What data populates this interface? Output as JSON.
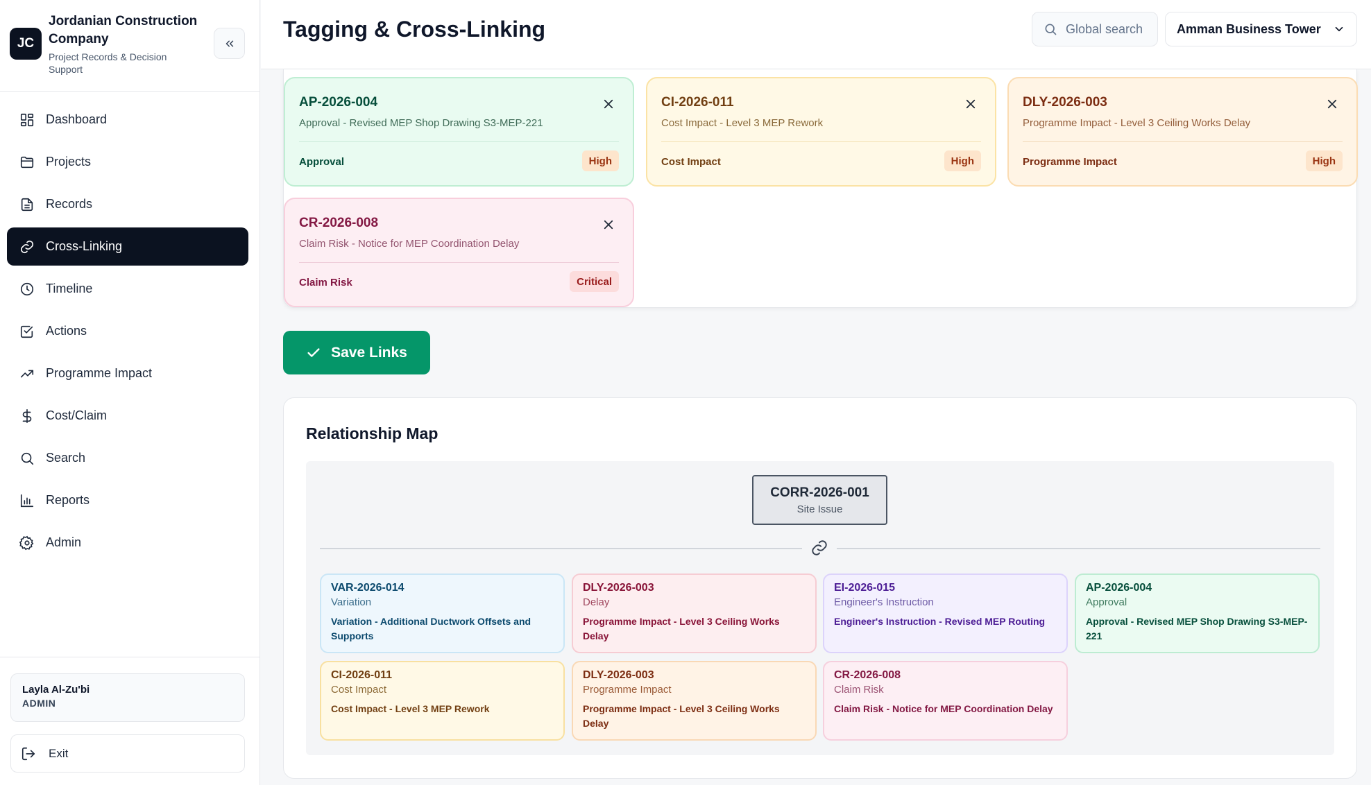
{
  "brand": {
    "logo": "JC",
    "name": "Jordanian Construction Company",
    "subtitle": "Project Records & Decision Support"
  },
  "sidebar": {
    "collapse_icon": "chevrons-left-icon",
    "items": [
      {
        "label": "Dashboard",
        "icon": "grid-icon",
        "active": false
      },
      {
        "label": "Projects",
        "icon": "folder-icon",
        "active": false
      },
      {
        "label": "Records",
        "icon": "file-icon",
        "active": false
      },
      {
        "label": "Cross-Linking",
        "icon": "link-icon",
        "active": true
      },
      {
        "label": "Timeline",
        "icon": "clock-icon",
        "active": false
      },
      {
        "label": "Actions",
        "icon": "checkbox-icon",
        "active": false
      },
      {
        "label": "Programme Impact",
        "icon": "trending-up-icon",
        "active": false
      },
      {
        "label": "Cost/Claim",
        "icon": "dollar-icon",
        "active": false
      },
      {
        "label": "Search",
        "icon": "search-icon",
        "active": false
      },
      {
        "label": "Reports",
        "icon": "bar-chart-icon",
        "active": false
      },
      {
        "label": "Admin",
        "icon": "gear-icon",
        "active": false
      }
    ],
    "user": {
      "name": "Layla Al-Zu'bi",
      "role": "ADMIN"
    },
    "exit_label": "Exit"
  },
  "header": {
    "title": "Tagging & Cross-Linking",
    "search_placeholder": "Global search",
    "project": "Amman Business Tower"
  },
  "linked_records": [
    {
      "id": "AP-2026-004",
      "description": "Approval - Revised MEP Shop Drawing S3-MEP-221",
      "category": "Approval",
      "priority": "High",
      "color": "green"
    },
    {
      "id": "CI-2026-011",
      "description": "Cost Impact - Level 3 MEP Rework",
      "category": "Cost Impact",
      "priority": "High",
      "color": "yellow"
    },
    {
      "id": "DLY-2026-003",
      "description": "Programme Impact - Level 3 Ceiling Works Delay",
      "category": "Programme Impact",
      "priority": "High",
      "color": "orange"
    },
    {
      "id": "CR-2026-008",
      "description": "Claim Risk - Notice for MEP Coordination Delay",
      "category": "Claim Risk",
      "priority": "Critical",
      "color": "pink"
    }
  ],
  "save_label": "Save Links",
  "relationship_map": {
    "title": "Relationship Map",
    "root": {
      "id": "CORR-2026-001",
      "type": "Site Issue"
    },
    "nodes": [
      {
        "id": "VAR-2026-014",
        "type": "Variation",
        "title": "Variation - Additional Ductwork Offsets and Supports",
        "color": "blue"
      },
      {
        "id": "DLY-2026-003",
        "type": "Delay",
        "title": "Programme Impact - Level 3 Ceiling Works Delay",
        "color": "red"
      },
      {
        "id": "EI-2026-015",
        "type": "Engineer's Instruction",
        "title": "Engineer's Instruction - Revised MEP Routing",
        "color": "purple"
      },
      {
        "id": "AP-2026-004",
        "type": "Approval",
        "title": "Approval - Revised MEP Shop Drawing S3-MEP-221",
        "color": "green"
      },
      {
        "id": "CI-2026-011",
        "type": "Cost Impact",
        "title": "Cost Impact - Level 3 MEP Rework",
        "color": "yellow"
      },
      {
        "id": "DLY-2026-003",
        "type": "Programme Impact",
        "title": "Programme Impact - Level 3 Ceiling Works Delay",
        "color": "orange"
      },
      {
        "id": "CR-2026-008",
        "type": "Claim Risk",
        "title": "Claim Risk - Notice for MEP Coordination Delay",
        "color": "pink"
      }
    ]
  }
}
